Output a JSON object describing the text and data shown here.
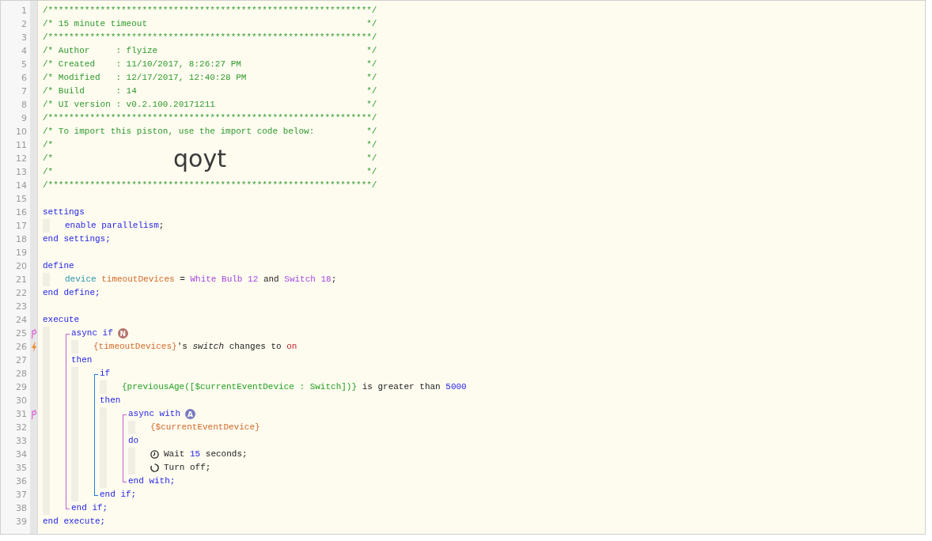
{
  "lines": [
    {
      "kind": "line",
      "number": "1",
      "tokens": [
        {
          "kind": "comment",
          "text": "/**************************************************************/"
        }
      ]
    },
    {
      "kind": "boxed",
      "number": "2",
      "tokens": [
        {
          "kind": "comment",
          "text": "/* 15 minute timeout"
        },
        {
          "kind": "comment",
          "text": "*/"
        }
      ]
    },
    {
      "kind": "line",
      "number": "3",
      "tokens": [
        {
          "kind": "comment",
          "text": "/**************************************************************/"
        }
      ]
    },
    {
      "kind": "boxed",
      "number": "4",
      "tokens": [
        {
          "kind": "comment",
          "text": "/* Author     : flyize"
        },
        {
          "kind": "comment",
          "text": "*/"
        }
      ]
    },
    {
      "kind": "boxed",
      "number": "5",
      "tokens": [
        {
          "kind": "comment",
          "text": "/* Created    : 11/10/2017, 8:26:27 PM"
        },
        {
          "kind": "comment",
          "text": "*/"
        }
      ]
    },
    {
      "kind": "boxed",
      "number": "6",
      "tokens": [
        {
          "kind": "comment",
          "text": "/* Modified   : 12/17/2017, 12:40:28 PM"
        },
        {
          "kind": "comment",
          "text": "*/"
        }
      ]
    },
    {
      "kind": "boxed",
      "number": "7",
      "tokens": [
        {
          "kind": "comment",
          "text": "/* Build      : 14"
        },
        {
          "kind": "comment",
          "text": "*/"
        }
      ]
    },
    {
      "kind": "boxed",
      "number": "8",
      "tokens": [
        {
          "kind": "comment",
          "text": "/* UI version : v0.2.100.20171211"
        },
        {
          "kind": "comment",
          "text": "*/"
        }
      ]
    },
    {
      "kind": "line",
      "number": "9",
      "tokens": [
        {
          "kind": "comment",
          "text": "/**************************************************************/"
        }
      ]
    },
    {
      "kind": "boxed",
      "number": "10",
      "tokens": [
        {
          "kind": "comment",
          "text": "/* To import this piston, use the import code below:"
        },
        {
          "kind": "comment",
          "text": "*/"
        }
      ]
    },
    {
      "kind": "boxed",
      "number": "11",
      "tokens": [
        {
          "kind": "comment",
          "text": "/*"
        },
        {
          "kind": "comment",
          "text": "*/"
        }
      ]
    },
    {
      "kind": "boxed",
      "number": "12",
      "tokens": [
        {
          "kind": "comment",
          "text": "/*"
        },
        {
          "kind": "comment",
          "text": "*/"
        }
      ],
      "import_code": "qoyt"
    },
    {
      "kind": "boxed",
      "number": "13",
      "tokens": [
        {
          "kind": "comment",
          "text": "/*"
        },
        {
          "kind": "comment",
          "text": "*/"
        }
      ]
    },
    {
      "kind": "line",
      "number": "14",
      "tokens": [
        {
          "kind": "comment",
          "text": "/**************************************************************/"
        }
      ]
    },
    {
      "kind": "line",
      "number": "15"
    },
    {
      "kind": "line",
      "number": "16",
      "tokens": [
        {
          "kind": "keyword",
          "text": "settings"
        }
      ],
      "children": [
        {
          "kind": "line",
          "number": "17",
          "tokens": [
            {
              "kind": "keyword",
              "text": "enable parallelism"
            },
            {
              "kind": "plain",
              "text": ";"
            }
          ]
        }
      ]
    },
    {
      "kind": "line",
      "number": "18",
      "tokens": [
        {
          "kind": "keyword",
          "text": "end settings;"
        }
      ]
    },
    {
      "kind": "line",
      "number": "19"
    },
    {
      "kind": "line",
      "number": "20",
      "tokens": [
        {
          "kind": "keyword",
          "text": "define"
        }
      ],
      "children": [
        {
          "kind": "line",
          "number": "21",
          "tokens": [
            {
              "kind": "type",
              "text": "device "
            },
            {
              "kind": "variable",
              "text": "timeoutDevices"
            },
            {
              "kind": "plain",
              "text": " = "
            },
            {
              "kind": "device",
              "text": "White Bulb 12"
            },
            {
              "kind": "plain",
              "text": " and "
            },
            {
              "kind": "device",
              "text": "Switch 18"
            },
            {
              "kind": "plain",
              "text": ";"
            }
          ]
        }
      ]
    },
    {
      "kind": "line",
      "number": "22",
      "tokens": [
        {
          "kind": "keyword",
          "text": "end define;"
        }
      ]
    },
    {
      "kind": "line",
      "number": "23"
    },
    {
      "kind": "line",
      "number": "24",
      "tokens": [
        {
          "kind": "keyword",
          "text": "execute"
        }
      ],
      "children": [
        {
          "kind": "block",
          "color": "#c25fd0",
          "children": [
            {
              "kind": "line",
              "number": "25",
              "gutter_marker": {
                "kind": "fork"
              },
              "tokens": [
                {
                  "kind": "keyword",
                  "text": "async if"
                },
                {
                  "kind": "badge",
                  "text": "N",
                  "color": "#b5726a"
                }
              ],
              "children": [
                {
                  "kind": "line",
                  "number": "26",
                  "gutter_marker": {
                    "kind": "bolt"
                  },
                  "tokens": [
                    {
                      "kind": "variable",
                      "text": "{timeoutDevices}"
                    },
                    {
                      "kind": "plain",
                      "text": "'s "
                    },
                    {
                      "kind": "attribute",
                      "text": "switch"
                    },
                    {
                      "kind": "plain",
                      "text": " changes to "
                    },
                    {
                      "kind": "value",
                      "text": "on"
                    }
                  ]
                }
              ]
            },
            {
              "kind": "line",
              "number": "27",
              "tokens": [
                {
                  "kind": "keyword",
                  "text": "then"
                }
              ],
              "children": [
                {
                  "kind": "block",
                  "color": "#1a7fe0",
                  "children": [
                    {
                      "kind": "line",
                      "number": "28",
                      "tokens": [
                        {
                          "kind": "keyword",
                          "text": "if"
                        }
                      ],
                      "children": [
                        {
                          "kind": "line",
                          "number": "29",
                          "tokens": [
                            {
                              "kind": "expression",
                              "text": "{previousAge([$currentEventDevice : Switch])}"
                            },
                            {
                              "kind": "plain",
                              "text": " is greater than "
                            },
                            {
                              "kind": "number",
                              "text": "5000"
                            }
                          ]
                        }
                      ]
                    },
                    {
                      "kind": "line",
                      "number": "30",
                      "tokens": [
                        {
                          "kind": "keyword",
                          "text": "then"
                        }
                      ],
                      "children": [
                        {
                          "kind": "block",
                          "color": "#c25fd0",
                          "children": [
                            {
                              "kind": "line",
                              "number": "31",
                              "gutter_marker": {
                                "kind": "fork"
                              },
                              "tokens": [
                                {
                                  "kind": "keyword",
                                  "text": "async with"
                                },
                                {
                                  "kind": "badge",
                                  "text": "A",
                                  "color": "#7a7cc0"
                                }
                              ],
                              "children": [
                                {
                                  "kind": "line",
                                  "number": "32",
                                  "tokens": [
                                    {
                                      "kind": "variable",
                                      "text": "{$currentEventDevice}"
                                    }
                                  ]
                                }
                              ]
                            },
                            {
                              "kind": "line",
                              "number": "33",
                              "tokens": [
                                {
                                  "kind": "keyword",
                                  "text": "do"
                                }
                              ],
                              "children": [
                                {
                                  "kind": "line",
                                  "number": "34",
                                  "tokens": [
                                    {
                                      "kind": "clock"
                                    },
                                    {
                                      "kind": "plain",
                                      "text": "Wait "
                                    },
                                    {
                                      "kind": "number",
                                      "text": "15"
                                    },
                                    {
                                      "kind": "plain",
                                      "text": " seconds;"
                                    }
                                  ]
                                },
                                {
                                  "kind": "line",
                                  "number": "35",
                                  "tokens": [
                                    {
                                      "kind": "ring"
                                    },
                                    {
                                      "kind": "plain",
                                      "text": "Turn off;"
                                    }
                                  ]
                                }
                              ]
                            },
                            {
                              "kind": "line",
                              "number": "36",
                              "tokens": [
                                {
                                  "kind": "keyword",
                                  "text": "end with;"
                                }
                              ]
                            }
                          ]
                        }
                      ]
                    },
                    {
                      "kind": "line",
                      "number": "37",
                      "tokens": [
                        {
                          "kind": "keyword",
                          "text": "end if;"
                        }
                      ]
                    }
                  ]
                }
              ]
            },
            {
              "kind": "line",
              "number": "38",
              "tokens": [
                {
                  "kind": "keyword",
                  "text": "end if;"
                }
              ]
            }
          ]
        }
      ]
    },
    {
      "kind": "line",
      "number": "39",
      "tokens": [
        {
          "kind": "keyword",
          "text": "end execute;"
        }
      ]
    }
  ]
}
